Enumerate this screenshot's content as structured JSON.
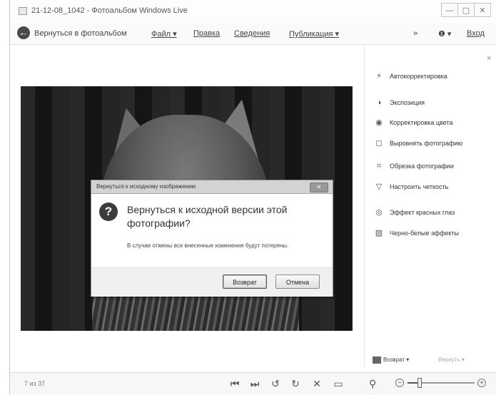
{
  "window": {
    "title": "21-12-08_1042 - Фотоальбом Windows Live",
    "minimize": "—",
    "maximize": "▢",
    "close": "✕"
  },
  "toolbar": {
    "back_icon": "back-arrow-icon",
    "back_label": "Вернуться в фотоальбом",
    "file": "Файл ▾",
    "fix": "Правка",
    "info": "Сведения",
    "publish": "Публикация ▾",
    "more": "»",
    "help": "❶ ▾",
    "signin": "Вход"
  },
  "panel": {
    "close": "×",
    "items": [
      {
        "icon": "magic-wand-icon",
        "glyph": "⚡",
        "label": "Автокорректировка"
      },
      {
        "icon": "exposure-icon",
        "glyph": "◑",
        "label": "Экспозиция"
      },
      {
        "icon": "color-icon",
        "glyph": "◉",
        "label": "Корректировка цвета"
      },
      {
        "icon": "straighten-icon",
        "glyph": "◻",
        "label": "Выровнять фотографию"
      },
      {
        "icon": "crop-icon",
        "glyph": "⌗",
        "label": "Обрезка фотографии"
      },
      {
        "icon": "sharpen-icon",
        "glyph": "▽",
        "label": "Настроить четкость"
      },
      {
        "icon": "red-eye-icon",
        "glyph": "◎",
        "label": "Эффект красных глаз"
      },
      {
        "icon": "bw-effects-icon",
        "glyph": "▨",
        "label": "Черно-белые эффекты"
      }
    ],
    "revert": "Возврат ▾",
    "redo": "Вернуть ▾"
  },
  "dialog": {
    "title": "Вернуться к исходному изображению",
    "close": "✕",
    "question": "Вернуться к исходной версии этой фотографии?",
    "description": "В случае отмены все внесенные изменения будут потеряны.",
    "ok": "Возврат",
    "cancel": "Отмена"
  },
  "bottom": {
    "counter": "7 из 37",
    "first": "⏮",
    "last": "⏭",
    "rotate_left": "↺",
    "rotate_right": "↻",
    "delete": "✕",
    "slideshow": "▭",
    "zoom_icon": "⚲",
    "zoom_minus": "−",
    "zoom_plus": "+",
    "zoom_level": 0.18
  }
}
